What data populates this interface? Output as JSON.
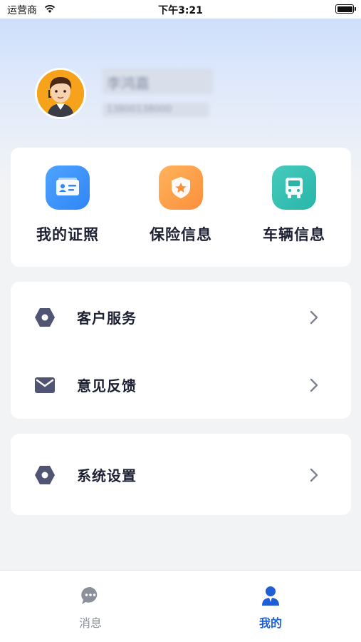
{
  "status_bar": {
    "carrier": "运营商",
    "time": "下午3:21"
  },
  "profile": {
    "name": "李鸿嘉",
    "phone": "13800138000"
  },
  "quick_actions": [
    {
      "label": "我的证照",
      "icon": "id-card-icon",
      "color": "#2f86f6"
    },
    {
      "label": "保险信息",
      "icon": "shield-star-icon",
      "color": "#fb8f3c"
    },
    {
      "label": "车辆信息",
      "icon": "truck-icon",
      "color": "#28b5a8"
    }
  ],
  "menu_group_1": [
    {
      "label": "客户服务",
      "icon": "hexagon-settings-icon"
    },
    {
      "label": "意见反馈",
      "icon": "envelope-icon"
    }
  ],
  "menu_group_2": [
    {
      "label": "系统设置",
      "icon": "hexagon-settings-icon"
    }
  ],
  "tab_bar": {
    "tabs": [
      {
        "label": "消息",
        "icon": "chat-bubble-icon",
        "active": false
      },
      {
        "label": "我的",
        "icon": "person-icon",
        "active": true
      }
    ],
    "active_color": "#1e5fd6",
    "inactive_color": "#8a8f99"
  }
}
